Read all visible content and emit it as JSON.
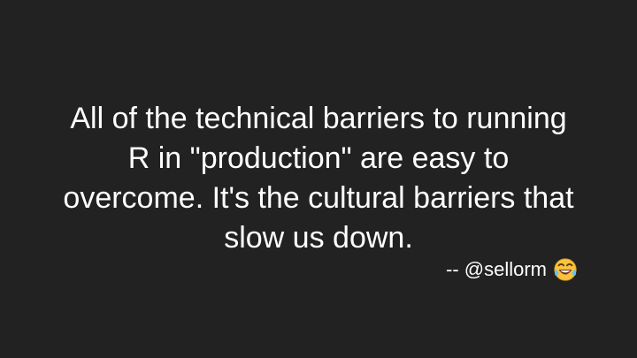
{
  "slide": {
    "quote_lines": [
      "All of the technical barriers to running",
      "R in \"production\" are easy to",
      "overcome. It's the cultural barriers that",
      "slow us down."
    ],
    "attribution": "-- @sellorm",
    "attribution_icon": "tears-of-joy-emoji-icon",
    "colors": {
      "background": "#222222",
      "text": "#ffffff",
      "emoji_face": "#f8c43a"
    }
  }
}
